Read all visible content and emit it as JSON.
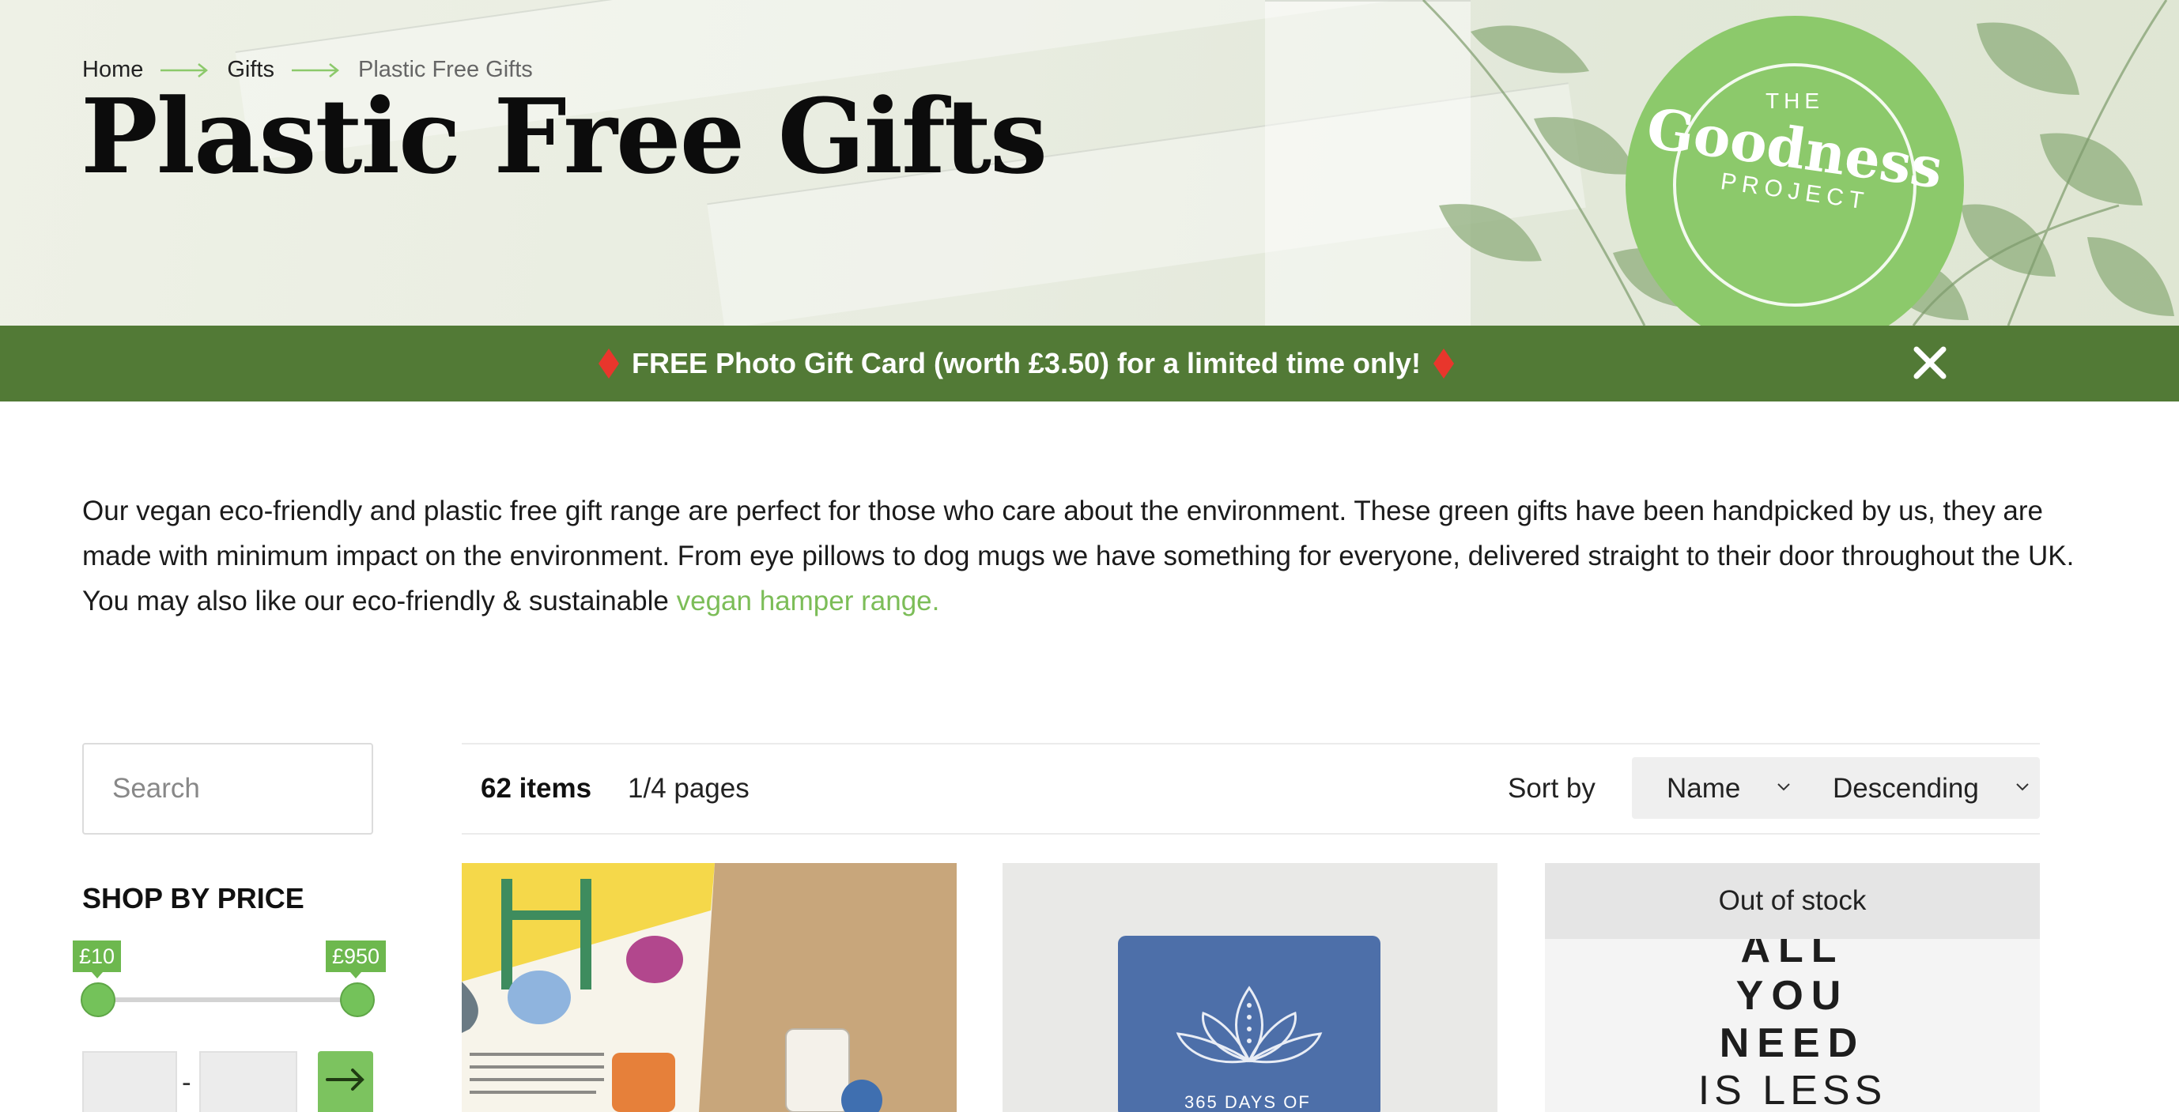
{
  "breadcrumb": {
    "home": "Home",
    "gifts": "Gifts",
    "current": "Plastic Free Gifts"
  },
  "page": {
    "title": "Plastic Free Gifts"
  },
  "logo": {
    "the": "THE",
    "name": "Goodness",
    "project": "PROJECT"
  },
  "promo": {
    "text": "FREE Photo Gift Card (worth £3.50) for a limited time only!"
  },
  "intro": {
    "text": "Our vegan eco-friendly and plastic free gift range are perfect for those who care about the environment. These green gifts have been handpicked by us, they are made with minimum impact on the environment. From eye pillows to dog mugs we have something for everyone, delivered straight to their door throughout the UK. You may also like our eco-friendly & sustainable ",
    "link": "vegan hamper range."
  },
  "sidebar": {
    "search_placeholder": "Search",
    "price_heading": "SHOP BY PRICE",
    "price_min": "£10",
    "price_max": "£950",
    "dash": "-"
  },
  "toolbar": {
    "items": "62 items",
    "pages": "1/4 pages",
    "sort_label": "Sort by",
    "sort_field": "Name",
    "sort_order": "Descending"
  },
  "products": [
    {
      "status": ""
    },
    {
      "status": "",
      "cover_text": "365 DAYS OF"
    },
    {
      "status": "Out of stock",
      "poster": [
        "ALL",
        "YOU",
        "NEED",
        "IS LESS"
      ]
    }
  ],
  "colors": {
    "accent": "#7cbd58",
    "promo_bg": "#527a36",
    "logo": "#8cc96b"
  }
}
